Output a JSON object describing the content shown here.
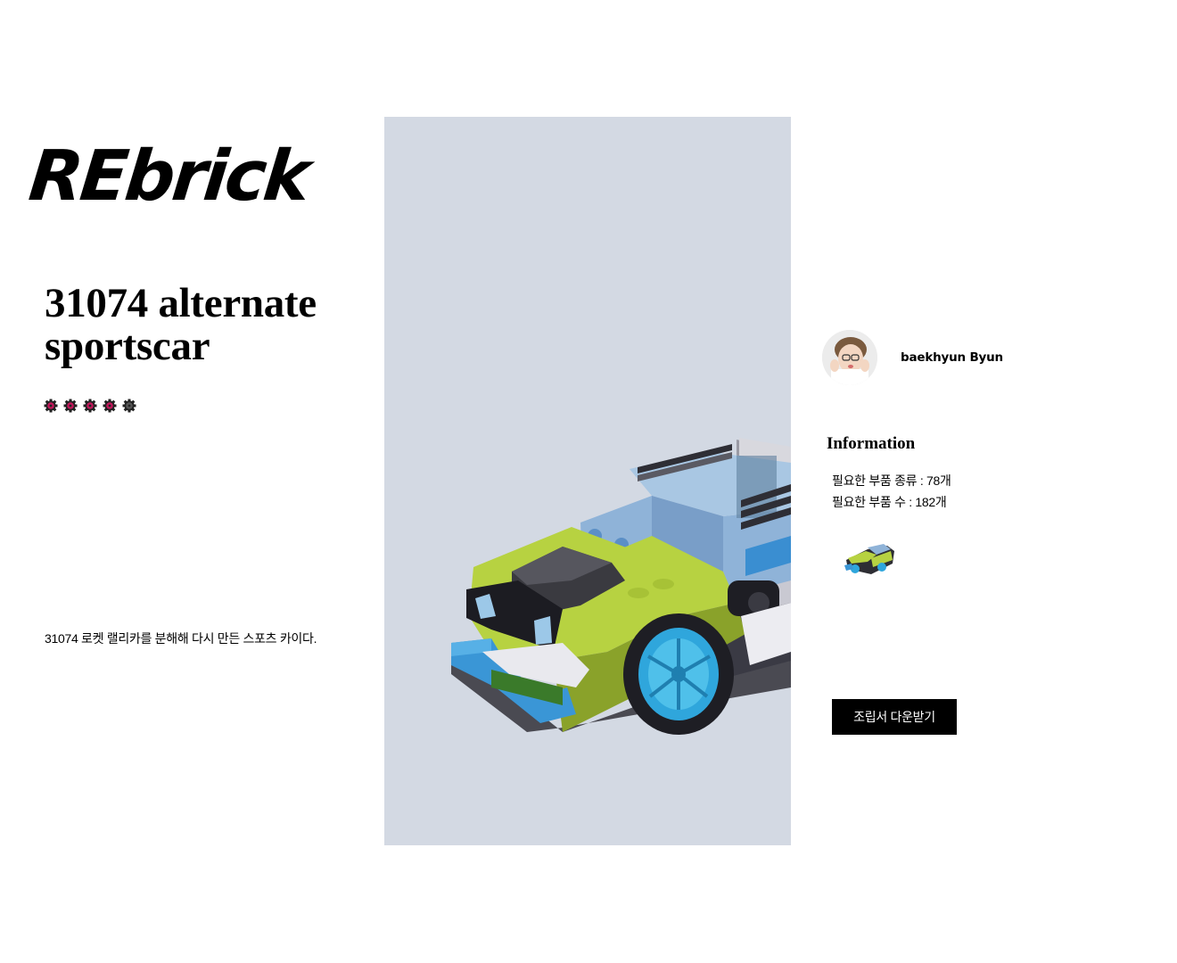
{
  "brand": {
    "logo_text": "REbrick"
  },
  "product": {
    "title": "31074 alternate sportscar",
    "rating": {
      "value": 4,
      "max": 5,
      "filled_color": "#c2185b",
      "empty_color": "#555555"
    },
    "description": "31074 로켓 랠리카를 분해해 다시 만든 스포츠 카이다."
  },
  "hero_image": {
    "subject": "lego-sportscar-illustration",
    "background": "#d3d9e3"
  },
  "author": {
    "name": "baekhyun Byun",
    "avatar": "profile-photo"
  },
  "information": {
    "heading": "Information",
    "items": [
      "필요한 부품 종류 : 78개",
      "필요한 부품 수 : 182개"
    ]
  },
  "thumbnail": {
    "subject": "lego-sportscar-thumbnail"
  },
  "actions": {
    "download_label": "조립서 다운받기"
  }
}
